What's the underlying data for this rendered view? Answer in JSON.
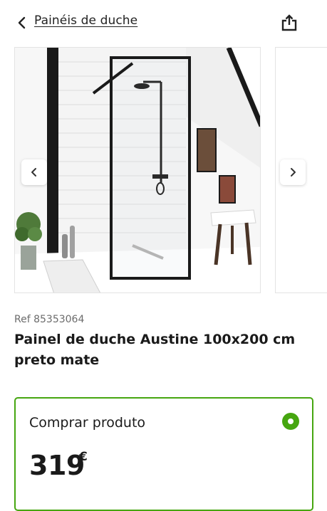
{
  "header": {
    "back_icon": "chevron-left-icon",
    "breadcrumb": "Painéis de duche",
    "share_icon": "share-icon"
  },
  "gallery": {
    "prev_icon": "chevron-left-icon",
    "next_icon": "chevron-right-icon",
    "image": "shower-panel-photo"
  },
  "product": {
    "ref": "Ref 85353064",
    "title": "Painel de duche Austine 100x200 cm preto mate"
  },
  "buy": {
    "label": "Comprar produto",
    "selected": true,
    "price": "319",
    "currency": "€"
  },
  "colors": {
    "accent_green": "#46a610",
    "frame_black": "#1a1a1a"
  }
}
